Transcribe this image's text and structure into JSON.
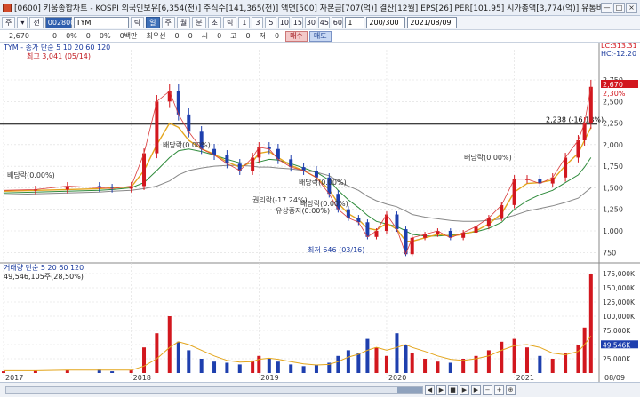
{
  "window": {
    "title": "[0600] 키움종합차트 - KOSPI 외국인보유[6,354(천)] 주식수[141,365(천)] 액면[500] 자본금[707(억)] 결산[12월] EPS[26] PER[101.95] 시가총액[3,774(억)] 유통비율[63.4",
    "controls": [
      "—",
      "□",
      "×"
    ]
  },
  "toolbar": {
    "items1": [
      "주",
      "▾",
      "전"
    ],
    "code": "002800",
    "search": "TYM",
    "periods": [
      "틱",
      "일",
      "주",
      "월",
      "분",
      "초",
      "틱"
    ],
    "numbers": [
      "1",
      "3",
      "5",
      "10",
      "15",
      "30",
      "45",
      "60"
    ],
    "unit": "1",
    "count": "200/300",
    "date": "2021/08/09"
  },
  "quote": {
    "price": "2,670",
    "f1": "0",
    "f2": "0%",
    "f3": "0",
    "f4": "0%",
    "f5": "0백만",
    "f6": "최우선",
    "f7": "0",
    "f8": "0",
    "f9": "시",
    "f10": "0",
    "f11": "고",
    "f12": "0",
    "f13": "저",
    "f14": "0",
    "buy": "매수",
    "sell": "매도"
  },
  "chart_data": {
    "type": "line",
    "title": "TYM",
    "price_legend": "TYM - 종가 단순 5  10  20  60  120",
    "volume_legend": "거래량 단순 5  20  60  120",
    "volume_value": "49,546,105주(28,50%)",
    "volume_current_label": "49,546K",
    "x_labels": [
      "2017",
      "2018",
      "2019",
      "2020",
      "2021",
      "08/09"
    ],
    "price_ticks": [
      "2,750",
      "2,500",
      "2,250",
      "2,000",
      "1,750",
      "1,500",
      "1,250",
      "1,000",
      "750"
    ],
    "price_ylim": [
      650,
      3100
    ],
    "volume_ticks": [
      "175,000K",
      "150,000K",
      "125,000K",
      "100,000K",
      "75,000K",
      "50,000K",
      "25,000K"
    ],
    "volume_ylim": [
      0,
      175000
    ],
    "current_price_label": "2,670",
    "current_pct_label": "2,30%",
    "lc_label": "LC:313.31",
    "hc_label": "HC:-12.20",
    "horizontal_line": {
      "value": 2238,
      "label": "2,238 (-16,18%)"
    },
    "annotations": [
      {
        "text": "최고 3,041 (05/14)",
        "color": "#c0181e"
      },
      {
        "text": "최저 646 (03/16)",
        "color": "#1a3a9e"
      },
      {
        "text": "배당락(0.00%)"
      },
      {
        "text": "배당락(0.00%)"
      },
      {
        "text": "배당락(0.00%)"
      },
      {
        "text": "배당락(0.00%)"
      },
      {
        "text": "배당락(0.00%)"
      },
      {
        "text": "유상증자(0.00%)"
      },
      {
        "text": "권리락(-17.24%)"
      }
    ],
    "price": {
      "x": [
        2017.0,
        2017.25,
        2017.5,
        2017.75,
        2017.85,
        2018.0,
        2018.1,
        2018.2,
        2018.3,
        2018.37,
        2018.45,
        2018.55,
        2018.65,
        2018.75,
        2018.85,
        2018.95,
        2019.0,
        2019.08,
        2019.15,
        2019.25,
        2019.35,
        2019.45,
        2019.55,
        2019.62,
        2019.7,
        2019.78,
        2019.85,
        2019.92,
        2020.0,
        2020.08,
        2020.15,
        2020.2,
        2020.3,
        2020.4,
        2020.5,
        2020.6,
        2020.7,
        2020.8,
        2020.9,
        2021.0,
        2021.1,
        2021.2,
        2021.3,
        2021.4,
        2021.5,
        2021.55,
        2021.6
      ],
      "close": [
        1470,
        1480,
        1520,
        1500,
        1490,
        1520,
        1900,
        2500,
        2620,
        2350,
        2150,
        1950,
        1880,
        1780,
        1700,
        1850,
        1970,
        1950,
        1830,
        1740,
        1700,
        1620,
        1430,
        1250,
        1150,
        1100,
        930,
        1000,
        1190,
        1020,
        730,
        920,
        960,
        1000,
        920,
        980,
        1050,
        1150,
        1300,
        1600,
        1600,
        1550,
        1620,
        1850,
        2050,
        2250,
        2670
      ],
      "ma20": [
        1460,
        1470,
        1480,
        1490,
        1500,
        1510,
        1700,
        2000,
        2250,
        2200,
        2050,
        1950,
        1890,
        1800,
        1740,
        1800,
        1900,
        1920,
        1850,
        1760,
        1700,
        1620,
        1480,
        1320,
        1200,
        1130,
        1030,
        1010,
        1090,
        1020,
        880,
        880,
        920,
        960,
        940,
        960,
        1000,
        1080,
        1200,
        1450,
        1550,
        1560,
        1590,
        1760,
        1900,
        2050,
        2200
      ],
      "ma60": [
        1440,
        1450,
        1460,
        1470,
        1480,
        1500,
        1560,
        1700,
        1850,
        1930,
        1950,
        1920,
        1880,
        1830,
        1790,
        1780,
        1800,
        1830,
        1820,
        1780,
        1730,
        1680,
        1590,
        1470,
        1360,
        1270,
        1180,
        1110,
        1080,
        1050,
        1000,
        960,
        940,
        940,
        950,
        970,
        990,
        1030,
        1100,
        1250,
        1350,
        1420,
        1470,
        1560,
        1650,
        1740,
        1850
      ],
      "ma120": [
        1420,
        1430,
        1440,
        1450,
        1460,
        1470,
        1490,
        1520,
        1580,
        1650,
        1700,
        1730,
        1750,
        1760,
        1760,
        1750,
        1740,
        1740,
        1730,
        1720,
        1700,
        1680,
        1640,
        1580,
        1520,
        1470,
        1400,
        1350,
        1310,
        1280,
        1230,
        1190,
        1160,
        1140,
        1120,
        1110,
        1110,
        1120,
        1140,
        1180,
        1230,
        1260,
        1290,
        1330,
        1380,
        1440,
        1500
      ]
    },
    "volume": {
      "values": [
        3,
        4,
        5,
        6,
        3,
        5,
        45,
        70,
        100,
        55,
        40,
        25,
        20,
        18,
        15,
        22,
        30,
        25,
        20,
        15,
        12,
        14,
        18,
        30,
        40,
        35,
        60,
        45,
        30,
        70,
        50,
        35,
        25,
        20,
        18,
        25,
        30,
        40,
        55,
        60,
        45,
        30,
        25,
        35,
        50,
        80,
        175
      ],
      "ma20": [
        4,
        4,
        5,
        5,
        5,
        5,
        12,
        25,
        45,
        55,
        50,
        40,
        30,
        22,
        19,
        20,
        24,
        26,
        24,
        20,
        16,
        14,
        15,
        20,
        28,
        33,
        40,
        45,
        40,
        45,
        50,
        45,
        38,
        30,
        24,
        22,
        25,
        30,
        40,
        48,
        50,
        45,
        35,
        32,
        38,
        50,
        65
      ]
    }
  },
  "colors": {
    "up": "#d2171e",
    "down": "#1e3fae",
    "ma5": "#d93b3b",
    "ma10": "#2a3fbf",
    "ma20": "#e3a51c",
    "ma60": "#2d8a3a",
    "ma120": "#888888",
    "grid": "#dcdcdc"
  },
  "bottom": {
    "nav": [
      "◀",
      "▶",
      "■",
      "▶",
      "▶",
      "−",
      "+",
      "⊕"
    ]
  }
}
